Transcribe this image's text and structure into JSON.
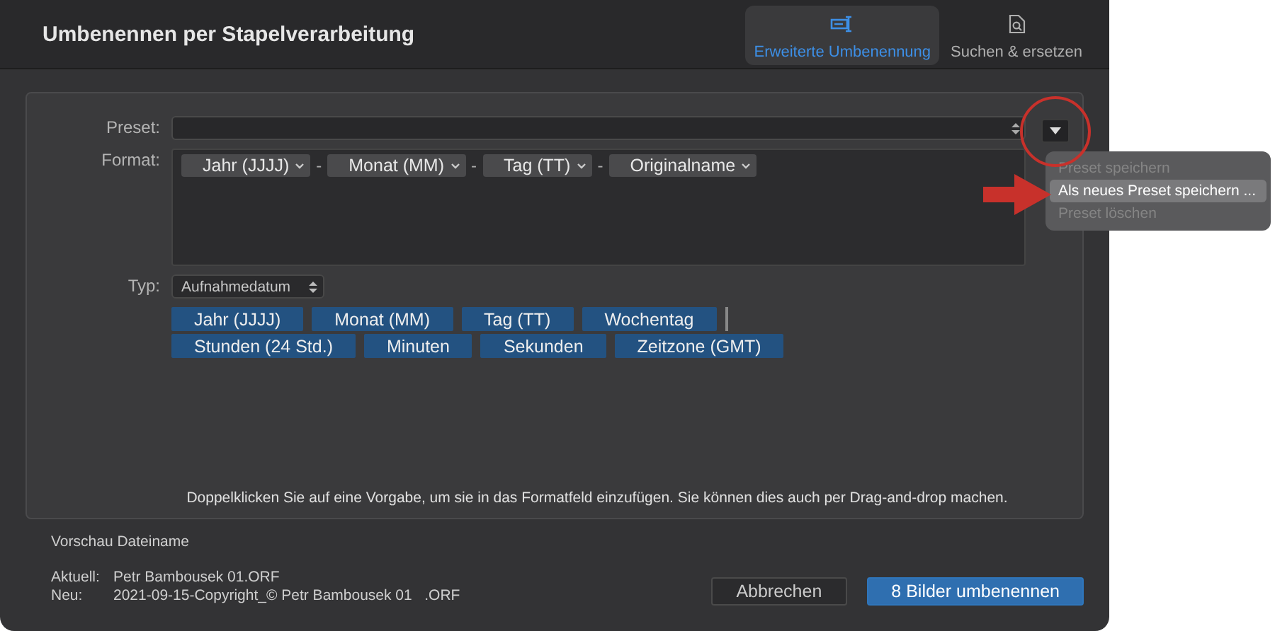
{
  "window": {
    "title": "Umbenennen per Stapelverarbeitung"
  },
  "tabs": [
    {
      "label": "Erweiterte Umbenennung",
      "kind": "rename",
      "selected": true
    },
    {
      "label": "Suchen & ersetzen",
      "kind": "search",
      "selected": false
    }
  ],
  "preset": {
    "label": "Preset:"
  },
  "format": {
    "label": "Format:",
    "tokens": [
      {
        "kind": "token",
        "label": "Jahr (JJJJ)"
      },
      {
        "kind": "separator",
        "label": "-"
      },
      {
        "kind": "token",
        "label": "Monat (MM)"
      },
      {
        "kind": "separator",
        "label": "-"
      },
      {
        "kind": "token",
        "label": "Tag (TT)"
      },
      {
        "kind": "separator",
        "label": "-"
      },
      {
        "kind": "token",
        "label": "Originalname"
      }
    ]
  },
  "type": {
    "label": "Typ:",
    "value": "Aufnahmedatum"
  },
  "presets": [
    [
      {
        "label": "Jahr (JJJJ)"
      },
      {
        "label": "Monat (MM)"
      },
      {
        "label": "Tag (TT)"
      },
      {
        "label": "Wochentag"
      }
    ],
    [
      {
        "label": "Stunden (24 Std.)"
      },
      {
        "label": "Minuten"
      },
      {
        "label": "Sekunden"
      },
      {
        "label": "Zeitzone (GMT)"
      }
    ]
  ],
  "hint": "Doppelklicken Sie auf eine Vorgabe, um sie in das Formatfeld einzufügen. Sie können dies auch per Drag-and-drop machen.",
  "preview": {
    "title": "Vorschau Dateiname",
    "rows": [
      {
        "label": "Aktuell:",
        "value": "Petr Bambousek 01.ORF"
      },
      {
        "label": "Neu:",
        "value": "2021-09-15-Copyright_© Petr Bambousek 01   .ORF"
      }
    ]
  },
  "buttons": [
    {
      "label": "Abbrechen",
      "kind": "secondary"
    },
    {
      "label": "8 Bilder umbenennen",
      "kind": "primary"
    }
  ],
  "menu": [
    {
      "label": "Preset speichern",
      "disabled": true,
      "selected": false
    },
    {
      "label": "Als neues Preset speichern ...",
      "disabled": false,
      "selected": true
    },
    {
      "label": "Preset löschen",
      "disabled": true,
      "selected": false
    }
  ]
}
